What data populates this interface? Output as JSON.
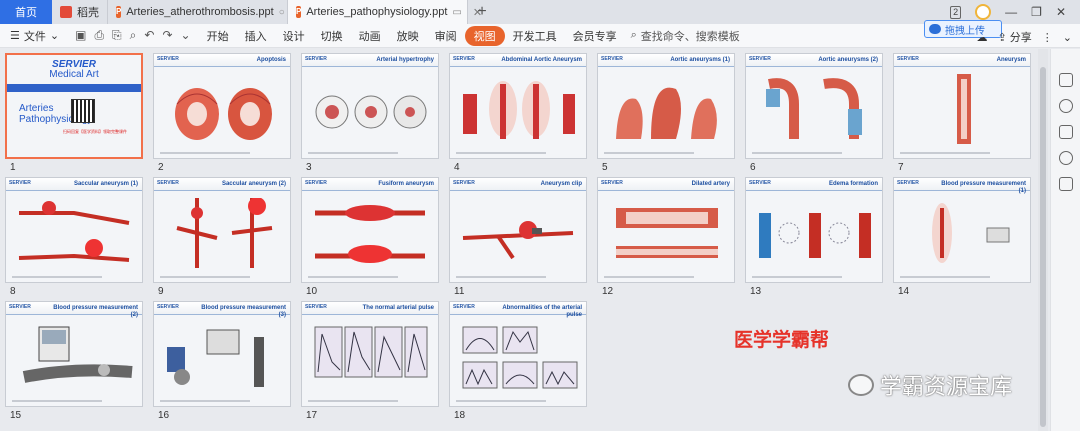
{
  "tabs": {
    "home": "首页",
    "items": [
      {
        "label": "稻壳",
        "icon": "docer-icon"
      },
      {
        "label": "Arteries_atherothrombosis.ppt",
        "icon": "ppt-icon",
        "status": "○"
      },
      {
        "label": "Arteries_pathophysiology.ppt",
        "icon": "ppt-icon",
        "active": true
      }
    ],
    "window_badge": "2"
  },
  "menu": {
    "file": "文件",
    "items": [
      "开始",
      "插入",
      "设计",
      "切换",
      "动画",
      "放映",
      "审阅",
      "视图",
      "开发工具",
      "会员专享"
    ],
    "selected": "视图",
    "search_placeholder": "查找命令、搜索模板",
    "upload": "拖拽上传",
    "share": "分享"
  },
  "slides": [
    {
      "num": "1",
      "title": "",
      "title_slide": {
        "brand1": "SERVIER",
        "brand2": "Medical Art",
        "t1": "Arteries",
        "t2": "Pathophysiology",
        "red": "扫码回复【医学资料】领取完整课件"
      }
    },
    {
      "num": "2",
      "title": "Apoptosis"
    },
    {
      "num": "3",
      "title": "Arterial hypertrophy"
    },
    {
      "num": "4",
      "title": "Abdominal Aortic Aneurysm"
    },
    {
      "num": "5",
      "title": "Aortic aneurysms (1)"
    },
    {
      "num": "6",
      "title": "Aortic aneurysms (2)"
    },
    {
      "num": "7",
      "title": "Aneurysm"
    },
    {
      "num": "8",
      "title": "Saccular aneurysm (1)"
    },
    {
      "num": "9",
      "title": "Saccular aneurysm (2)"
    },
    {
      "num": "10",
      "title": "Fusiform aneurysm"
    },
    {
      "num": "11",
      "title": "Aneurysm clip"
    },
    {
      "num": "12",
      "title": "Dilated artery"
    },
    {
      "num": "13",
      "title": "Edema formation"
    },
    {
      "num": "14",
      "title": "Blood pressure measurement (1)"
    },
    {
      "num": "15",
      "title": "Blood pressure measurement (2)"
    },
    {
      "num": "16",
      "title": "Blood pressure measurement (3)"
    },
    {
      "num": "17",
      "title": "The normal arterial pulse"
    },
    {
      "num": "18",
      "title": "Abnormalities of the arterial pulse"
    }
  ],
  "slide_brand": "SERVIER",
  "watermarks": {
    "red": "医学学霸帮",
    "grey": "学霸资源宝库"
  },
  "colors": {
    "accent": "#e8642c",
    "tab_home": "#2f6fe4",
    "slide_title": "#1d4fa0"
  }
}
